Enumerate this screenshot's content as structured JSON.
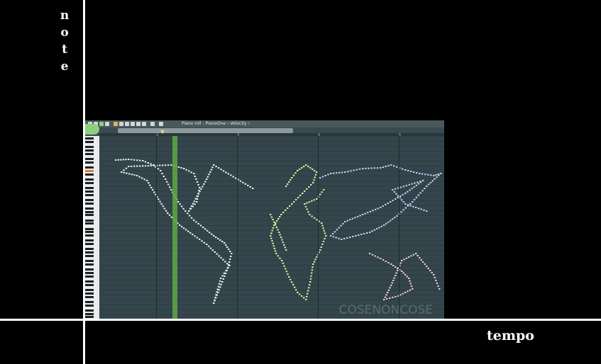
{
  "labels": {
    "y_axis": "note",
    "x_axis": "tempo"
  },
  "screenshot": {
    "window_title": "Piano roll - PianoOne › Velocity ›",
    "ruler_marks": [
      "2",
      "3",
      "4",
      "5"
    ],
    "watermark": "COSENONCOSE"
  },
  "colors": {
    "background": "#000000",
    "roll_background": "#34454c",
    "playhead": "#5fa843",
    "note_white": "#e8f2f2",
    "note_yellow": "#d9f0a0",
    "note_blue": "#c5cff5",
    "note_pink": "#f0c8dc"
  },
  "icons": [
    "arrow-icon",
    "magnet-icon",
    "play-icon",
    "loop-icon",
    "pencil-icon",
    "brush-icon",
    "delete-icon",
    "mute-icon",
    "slice-icon",
    "select-icon",
    "zoom-icon",
    "speaker-icon"
  ]
}
